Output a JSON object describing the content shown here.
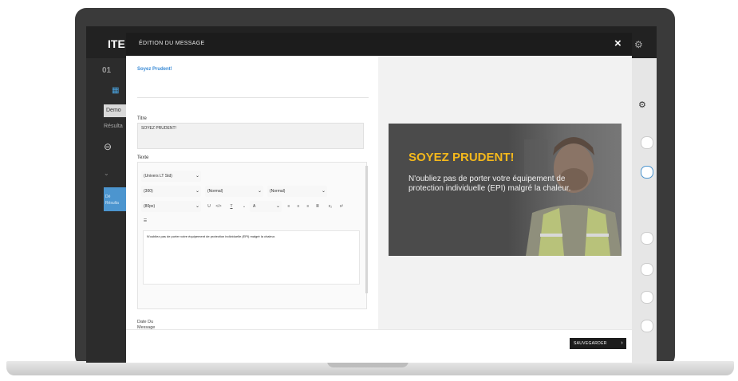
{
  "app": {
    "brand": "ITE",
    "sub": "01",
    "demo_label": "Demo",
    "result_label": "Résulta",
    "side_btn": "Dé Résulta"
  },
  "modal": {
    "title": "ÉDITION DU MESSAGE",
    "close_icon": "close-icon",
    "heading": "Soyez Prudent!",
    "title_label": "Titre",
    "title_value": "SOYEZ PRUDENT!",
    "text_label": "Texte",
    "toolbar": {
      "font": "(Univers LT Std)",
      "size": "(300)",
      "style1": "(Normal)",
      "style2": "(Normal)",
      "px": "(80px)",
      "a_label": "A"
    },
    "message": "N'oubliez pas de porter votre équipement de protection individuelle (EPI) malgré la chaleur.",
    "date_label_1": "Date Du",
    "date_label_2": "Message",
    "save_label": "SAUVEGARDER"
  },
  "preview": {
    "title": "SOYEZ PRUDENT!",
    "body": "N'oubliez pas de porter votre équipement de protection individuelle (EPI) malgré la chaleur."
  },
  "colors": {
    "accent": "#f4b81c",
    "link": "#3a8bd6",
    "dark": "#1c1c1c"
  }
}
